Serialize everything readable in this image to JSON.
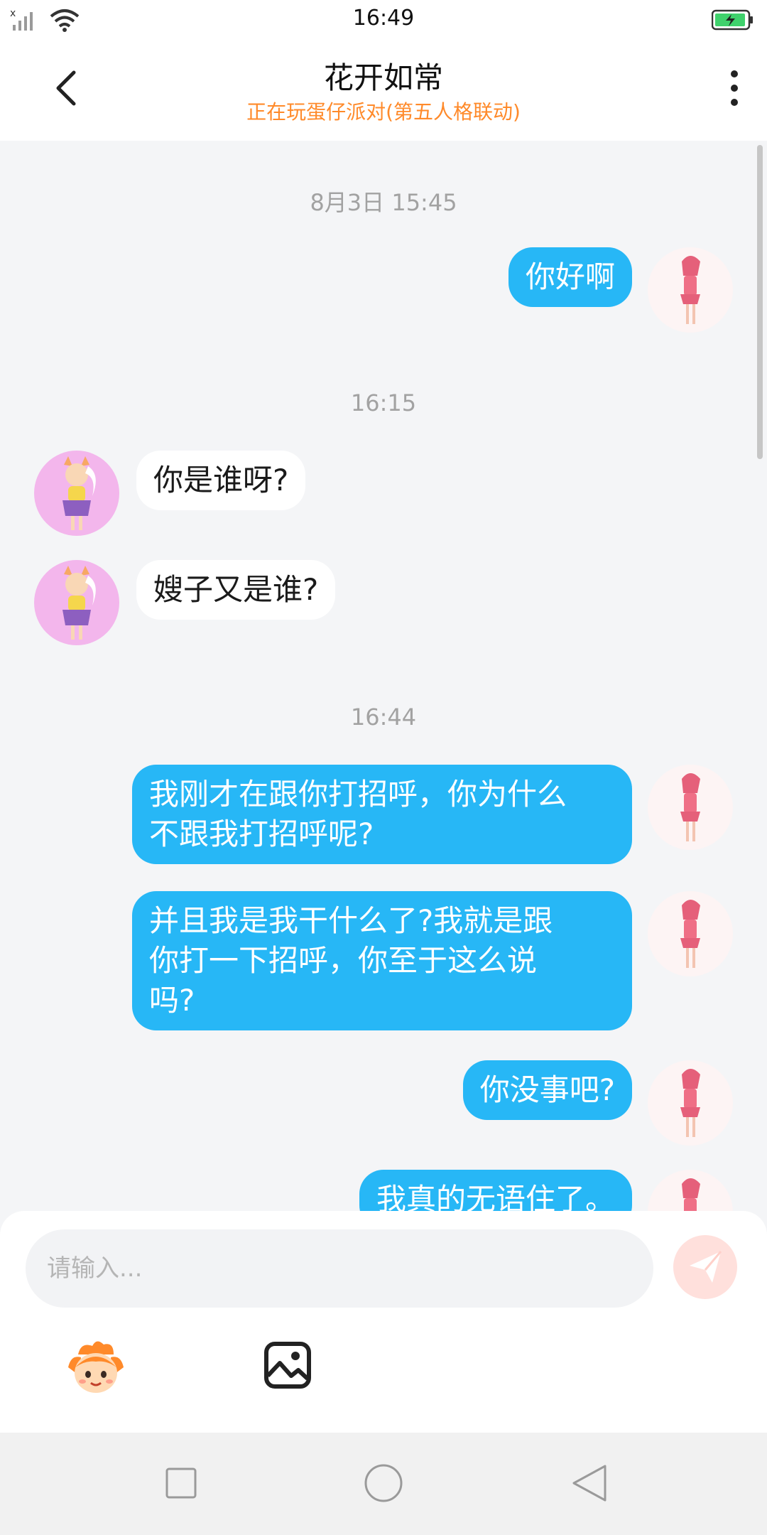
{
  "status_bar": {
    "time": "16:49"
  },
  "header": {
    "title": "花开如常",
    "subtitle": "正在玩蛋仔派对(第五人格联动)"
  },
  "messages": [
    {
      "type": "time",
      "text": "8月3日 15:45"
    },
    {
      "type": "msg",
      "from": "me",
      "text": "你好啊"
    },
    {
      "type": "time",
      "text": "16:15"
    },
    {
      "type": "msg",
      "from": "them",
      "text": "你是谁呀?"
    },
    {
      "type": "msg",
      "from": "them",
      "text": "嫂子又是谁?"
    },
    {
      "type": "time",
      "text": "16:44"
    },
    {
      "type": "msg",
      "from": "me",
      "text": "我刚才在跟你打招呼，你为什么\n不跟我打招呼呢?"
    },
    {
      "type": "msg",
      "from": "me",
      "text": "并且我是我干什么了?我就是跟\n你打一下招呼，你至于这么说\n吗?"
    },
    {
      "type": "msg",
      "from": "me",
      "text": "你没事吧?"
    },
    {
      "type": "msg",
      "from": "me",
      "text": "我真的无语住了。"
    }
  ],
  "input": {
    "placeholder": "请输入..."
  },
  "icons": {
    "back": "chevron-left-icon",
    "more": "more-vertical-icon",
    "send": "send-icon",
    "emoji": "eggy-emoji-icon",
    "image": "image-icon"
  },
  "colors": {
    "my_bubble": "#27b7f6",
    "their_bubble": "#ffffff",
    "status_text": "#ff8a2a",
    "background": "#f4f5f7"
  }
}
